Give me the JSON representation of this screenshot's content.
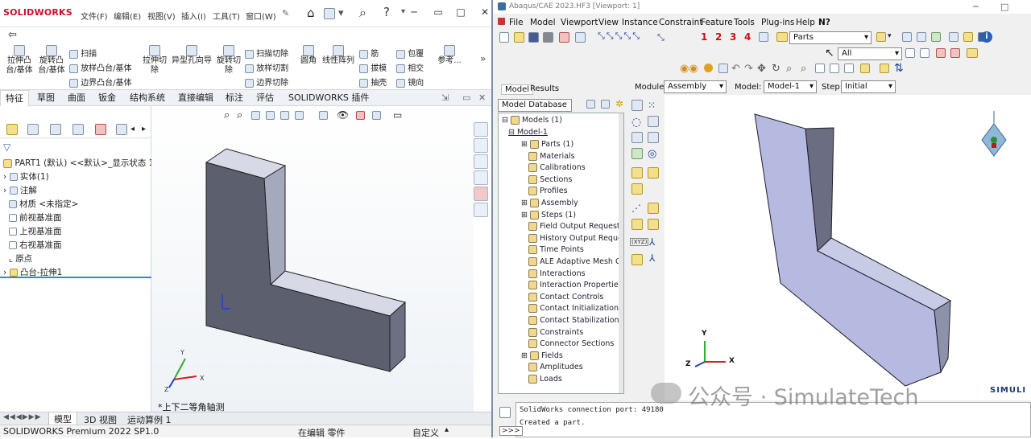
{
  "solidworks": {
    "logo_text": "SOLIDWORKS",
    "menu": [
      "文件(F)",
      "编辑(E)",
      "视图(V)",
      "插入(I)",
      "工具(T)",
      "窗口(W)"
    ],
    "ribbon": {
      "extrude_boss": "拉伸凸\n台/基体",
      "revolve_boss": "旋转凸\n台/基体",
      "sweep": "扫描",
      "loft": "放样凸台/基体",
      "boundary_boss": "边界凸台/基体",
      "extrude_cut": "拉伸切\n除",
      "hole_wizard": "异型孔向导",
      "revolve_cut": "旋转切\n除",
      "swept_cut": "扫描切除",
      "lofted_cut": "放样切割",
      "boundary_cut": "边界切除",
      "fillet": "圆角",
      "linear_pattern": "线性阵列",
      "rib": "筋",
      "draft": "拔模",
      "shell": "抽壳",
      "wrap": "包覆",
      "intersect": "相交",
      "mirror": "镜向",
      "reference": "参考..."
    },
    "tabs": [
      "特征",
      "草图",
      "曲面",
      "钣金",
      "结构系统",
      "直接编辑",
      "标注",
      "评估",
      "SOLIDWORKS 插件"
    ],
    "tree": {
      "root": "PART1 (默认) <<默认>_显示状态 1:",
      "items": [
        "实体(1)",
        "注解",
        "材质 <未指定>",
        "前视基准面",
        "上视基准面",
        "右视基准面",
        "原点",
        "凸台-拉伸1"
      ]
    },
    "view_label": "*上下二等角轴测",
    "bottom_tabs": [
      "模型",
      "3D 视图",
      "运动算例 1"
    ],
    "status": {
      "version": "SOLIDWORKS Premium 2022 SP1.0",
      "editing": "在编辑 零件",
      "custom": "自定义"
    },
    "axes": {
      "x": "X",
      "y": "Y",
      "z": "Z"
    }
  },
  "abaqus": {
    "title": "Abaqus/CAE 2023.HF3 [Viewport: 1]",
    "menu": [
      "File",
      "Model",
      "Viewport",
      "View",
      "Instance",
      "Constraint",
      "Feature",
      "Tools",
      "Plug-ins",
      "Help",
      "N?"
    ],
    "red_numbers": [
      "1",
      "2",
      "3",
      "4"
    ],
    "parts_combo": "Parts",
    "all_combo": "All",
    "tabs": {
      "model": "Model",
      "results": "Results"
    },
    "module_label": "Module:",
    "module_value": "Assembly",
    "model_label": "Model:",
    "model_value": "Model-1",
    "step_label": "Step:",
    "step_value": "Initial",
    "db_combo": "Model Database",
    "tree": {
      "models": "Models (1)",
      "model1": "Model-1",
      "items": [
        "Parts (1)",
        "Materials",
        "Calibrations",
        "Sections",
        "Profiles",
        "Assembly",
        "Steps (1)",
        "Field Output Requests",
        "History Output Requests",
        "Time Points",
        "ALE Adaptive Mesh Con",
        "Interactions",
        "Interaction Properties",
        "Contact Controls",
        "Contact Initializations",
        "Contact Stabilizations",
        "Constraints",
        "Connector Sections",
        "Fields",
        "Amplitudes",
        "Loads"
      ]
    },
    "messages": [
      "SolidWorks connection port: 49180",
      "Created a part."
    ],
    "brand": "SIMULI",
    "axes": {
      "x": "X",
      "y": "Y",
      "z": "Z"
    }
  },
  "watermark": "公众号 · SimulateTech",
  "colors": {
    "sw_red": "#c8102e",
    "abaqus_red": "#d01010",
    "part_gray": "#5b5f6e",
    "part_face": "#c8cbe6"
  }
}
